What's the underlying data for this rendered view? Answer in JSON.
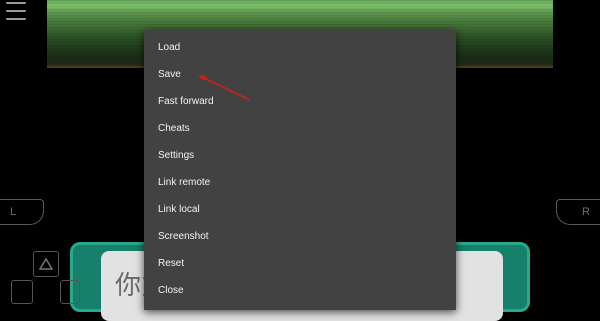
{
  "menu": {
    "items": [
      {
        "label": "Load"
      },
      {
        "label": "Save"
      },
      {
        "label": "Fast forward"
      },
      {
        "label": "Cheats"
      },
      {
        "label": "Settings"
      },
      {
        "label": "Link remote"
      },
      {
        "label": "Link local"
      },
      {
        "label": "Screenshot"
      },
      {
        "label": "Reset"
      },
      {
        "label": "Close"
      }
    ]
  },
  "controls": {
    "shoulder_left": "L",
    "shoulder_right": "R"
  },
  "game_dialog": {
    "text": "你好"
  },
  "icons": {
    "menu": "hamburger-menu-icon",
    "dpad_up": "triangle-up-icon",
    "annotation": "red-arrow-icon"
  },
  "colors": {
    "menu_bg": "#424242",
    "annotation": "#cc1f1f",
    "dialog_frame": "#17806a"
  }
}
